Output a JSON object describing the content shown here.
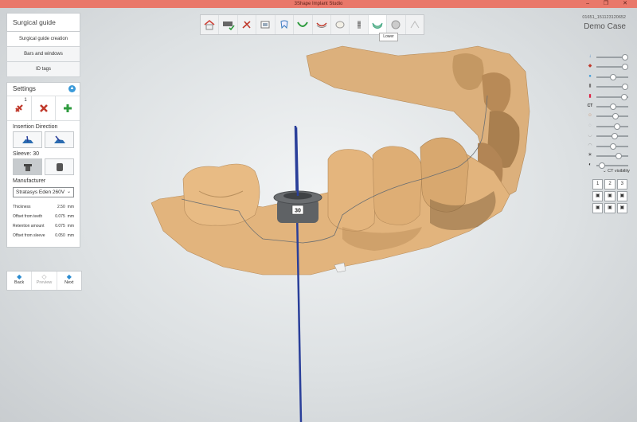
{
  "app": {
    "title": "3Shape Implant Studio",
    "window_buttons": "–  ❐  ✕"
  },
  "case": {
    "id": "01651_151123120652",
    "name": "Demo Case"
  },
  "left_panel": {
    "header": "Surgical guide",
    "nav": [
      "Surgical guide creation",
      "Bars and windows",
      "ID tags"
    ],
    "settings": {
      "title": "Settings",
      "badge": "1",
      "insertion_direction_label": "Insertion Direction",
      "sleeve_label": "Sleeve: 30",
      "manufacturer_label": "Manufacturer",
      "manufacturer_value": "Stratasys Eden 260V",
      "params": [
        {
          "label": "Thickness",
          "value": "2.50",
          "unit": "mm"
        },
        {
          "label": "Offset from teeth",
          "value": "0.075",
          "unit": "mm"
        },
        {
          "label": "Retention amount",
          "value": "0.075",
          "unit": "mm"
        },
        {
          "label": "Offset from sleeve",
          "value": "0.050",
          "unit": "mm"
        }
      ]
    },
    "bottom_nav": {
      "back": "Back",
      "preview": "Preview",
      "next": "Next"
    }
  },
  "toolbar": {
    "items": [
      "home-icon",
      "scan-check-icon",
      "tools-icon",
      "ct-icon",
      "tooth-implant-icon",
      "arch-icon",
      "nerve-icon",
      "crown-icon",
      "implant-icon",
      "guide-lower-icon",
      "sphere-icon",
      "measure-icon"
    ],
    "tooltip": "Lower"
  },
  "viewport": {
    "sleeve_label": "30"
  },
  "right_panel": {
    "slider_levels": [
      0.95,
      0.95,
      0.5,
      0.95,
      0.9,
      0.5,
      0.6,
      0.65,
      0.55,
      0.5,
      0.7,
      0.1
    ],
    "ct_label": "CT",
    "ct_visibility_label": "CT visibility",
    "view_buttons": [
      "1",
      "2",
      "3"
    ]
  },
  "colors": {
    "accent": "#3a9ad9",
    "titlebar": "#e9786a",
    "model": "#e2b47d",
    "axis": "#2a3f9a"
  }
}
